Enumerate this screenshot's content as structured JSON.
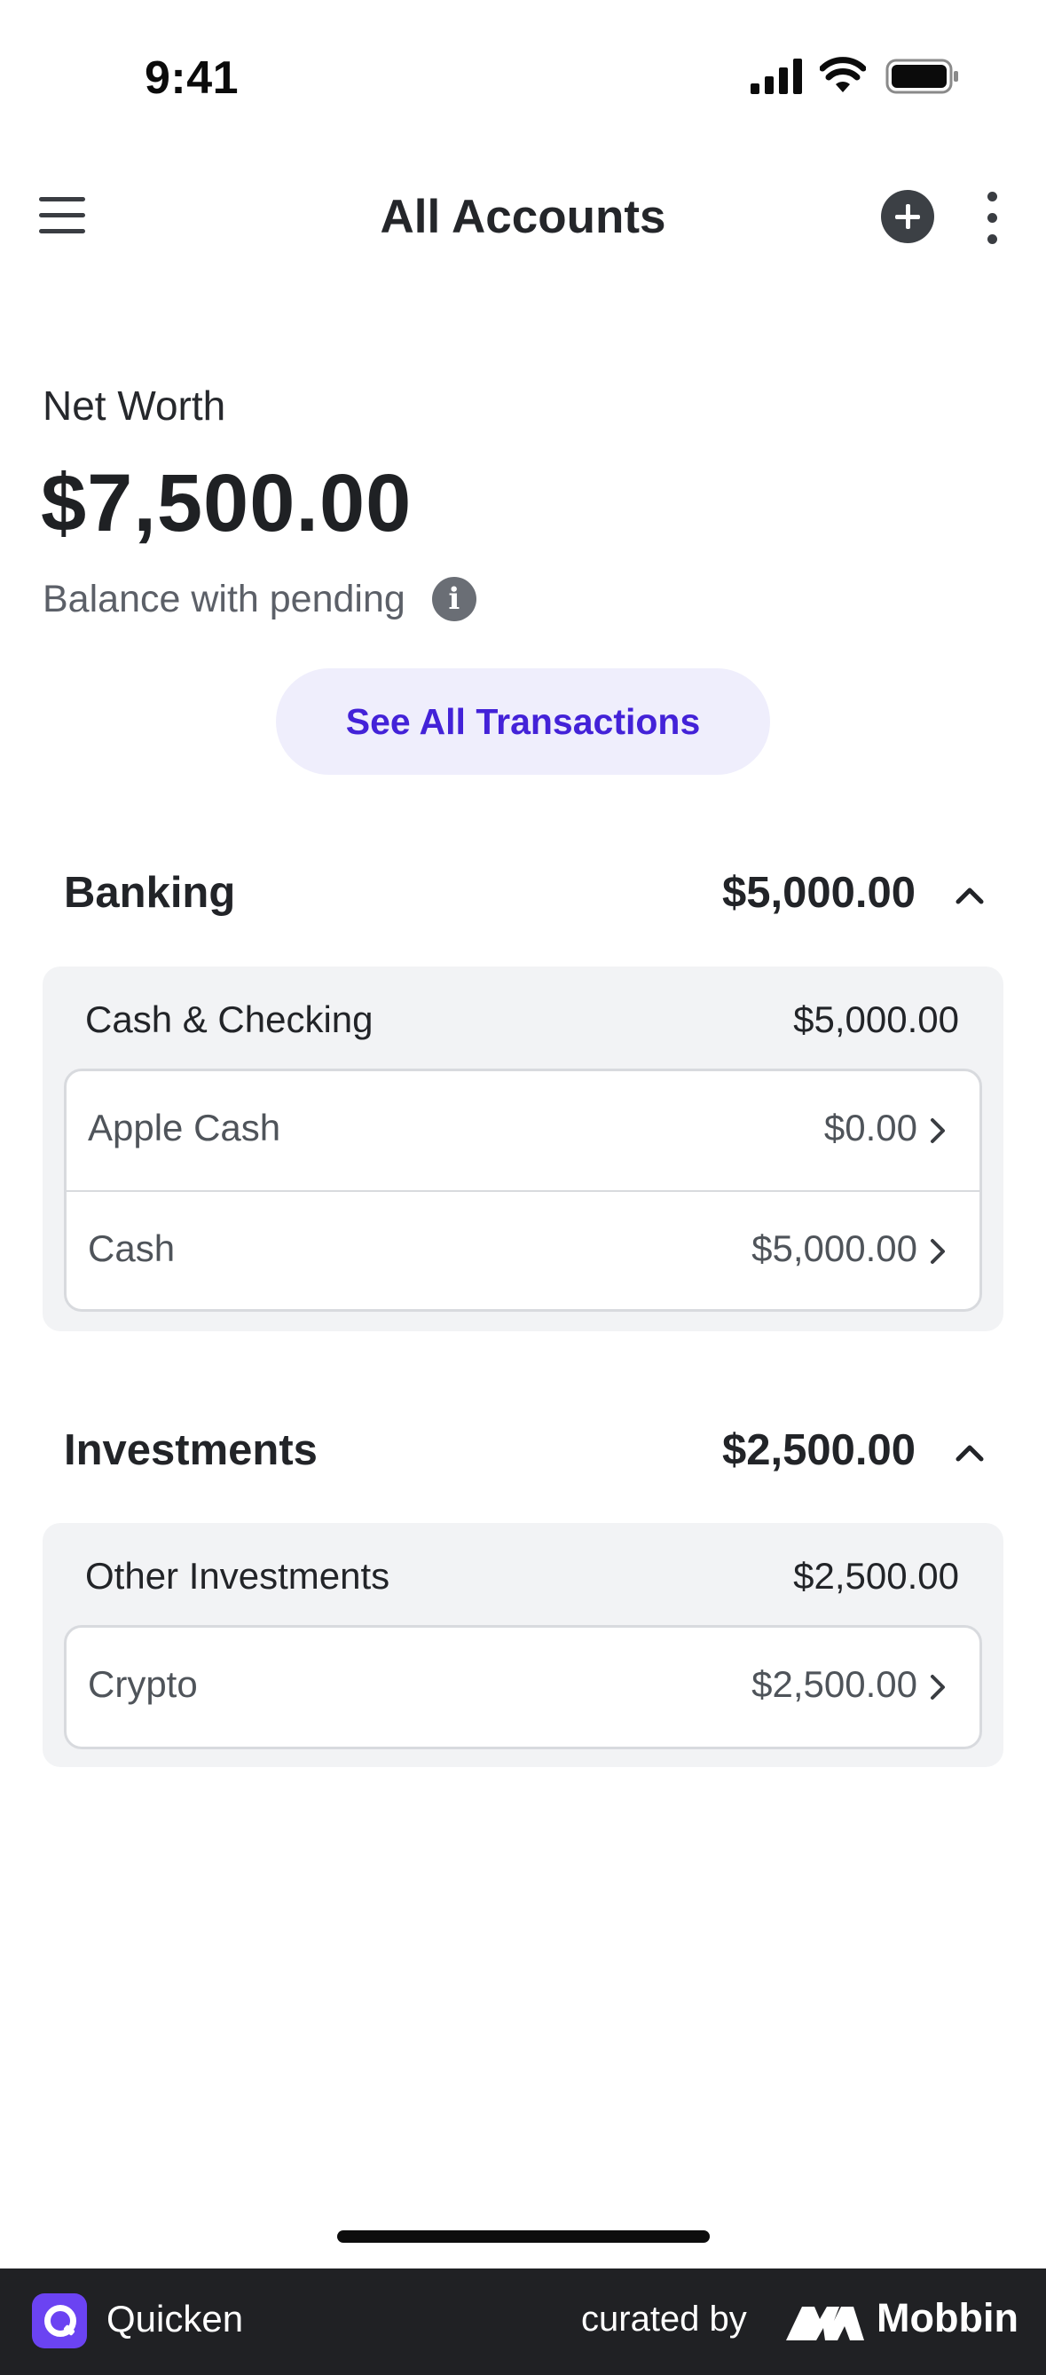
{
  "status_bar": {
    "time": "9:41",
    "icons": [
      "signal-icon",
      "wifi-icon",
      "battery-icon"
    ]
  },
  "nav": {
    "title": "All Accounts",
    "icons": [
      "menu-icon",
      "add-icon",
      "more-icon"
    ]
  },
  "net_worth": {
    "label": "Net Worth",
    "value": "$7,500.00",
    "pending_label": "Balance with pending",
    "info_glyph": "i"
  },
  "see_all_label": "See All Transactions",
  "banking": {
    "title": "Banking",
    "total": "$5,000.00",
    "group": {
      "name": "Cash & Checking",
      "amount": "$5,000.00"
    },
    "accounts": [
      {
        "name": "Apple Cash",
        "amount": "$0.00"
      },
      {
        "name": "Cash",
        "amount": "$5,000.00"
      }
    ]
  },
  "investments": {
    "title": "Investments",
    "total": "$2,500.00",
    "group": {
      "name": "Other Investments",
      "amount": "$2,500.00"
    },
    "accounts": [
      {
        "name": "Crypto",
        "amount": "$2,500.00"
      }
    ]
  },
  "footer": {
    "app_name": "Quicken",
    "curated_by": "curated by",
    "brand": "Mobbin"
  },
  "colors": {
    "accent": "#4322d8",
    "accent_bg": "#efeefc",
    "quicken_brand": "#6b43f2",
    "footer_bg": "#202124",
    "group_bg": "#f2f3f5"
  }
}
